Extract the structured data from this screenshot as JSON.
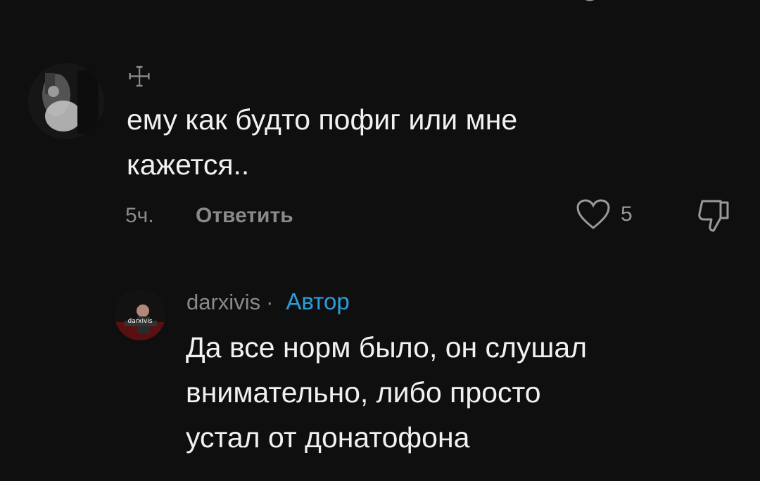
{
  "comment": {
    "username": "☩",
    "text": "ему как будто пофиг или мне\nкажется..",
    "time": "5ч.",
    "reply_label": "Ответить",
    "like_count": "5",
    "icons": {
      "avatar": "avatar-image",
      "like": "heart-icon",
      "dislike": "thumbs-down-icon"
    }
  },
  "reply": {
    "username": "darxivis",
    "separator": "·",
    "badge": "Автор",
    "text": "Да все норм было, он слушал\nвнимательно, либо просто\nустал от донатофона",
    "colors": {
      "badge": "#2b9ed8"
    }
  },
  "colors": {
    "background": "#0f0f0f",
    "text": "#f1f1f1",
    "muted": "#8a8a8a"
  }
}
